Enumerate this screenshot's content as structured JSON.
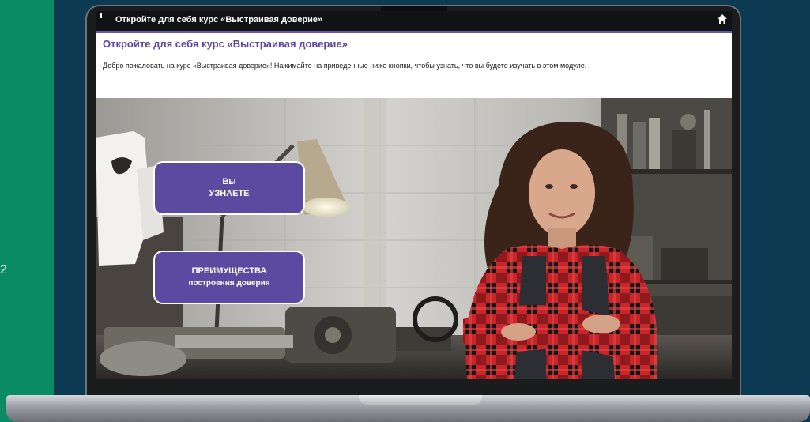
{
  "page": {
    "side_number": "2"
  },
  "course_window": {
    "title_bar": "Откройте для себя курс «Выстраивая доверие»",
    "home_icon": "home-icon",
    "heading": "Откройте для себя курс «Выстраивая доверие»",
    "intro": "Добро пожаловать на курс «Выстраивая доверие»! Нажимайте на приведенные ниже кнопки, чтобы узнать, что вы будете изучать в этом модуле."
  },
  "buttons": {
    "learn": {
      "line1": "Вы",
      "line2": "УЗНАЕТЕ"
    },
    "benefits": {
      "line1": "ПРЕИМУЩЕСТВА",
      "line2": "построения доверия"
    }
  },
  "colors": {
    "green_panel": "#0b8b63",
    "background": "#0b3a52",
    "accent_purple": "#5a4aa0",
    "heading_purple": "#5a45a0"
  }
}
